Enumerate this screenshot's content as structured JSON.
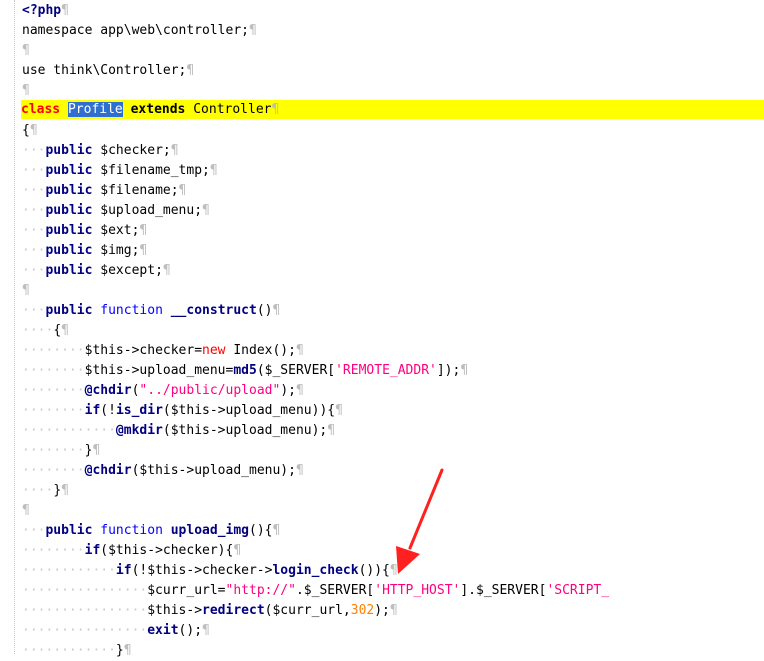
{
  "editor": {
    "lines": [
      [
        "<?php"
      ],
      [
        "namespace app\\web\\controller;"
      ],
      [
        ""
      ],
      [
        "use think\\Controller;"
      ],
      [
        ""
      ],
      [
        "class",
        " ",
        "Profile",
        " ",
        "extends",
        " Controller"
      ],
      [
        "{"
      ],
      [
        "public",
        " $checker;"
      ],
      [
        "public",
        " $filename_tmp;"
      ],
      [
        "public",
        " $filename;"
      ],
      [
        "public",
        " $upload_menu;"
      ],
      [
        "public",
        " $ext;"
      ],
      [
        "public",
        " $img;"
      ],
      [
        "public",
        " $except;"
      ],
      [
        ""
      ],
      [
        "public",
        " ",
        "function",
        " ",
        "__construct",
        "()"
      ],
      [
        "{"
      ],
      [
        "$this->checker=",
        "new",
        " Index();"
      ],
      [
        "$this->upload_menu=",
        "md5",
        "($_SERVER[",
        "'REMOTE_ADDR'",
        "]);"
      ],
      [
        "@chdir",
        "(",
        "\"../public/upload\"",
        ");"
      ],
      [
        "if",
        "(!",
        "is_dir",
        "($this->upload_menu)){"
      ],
      [
        "@mkdir",
        "($this->upload_menu);"
      ],
      [
        "}"
      ],
      [
        "@chdir",
        "($this->upload_menu);"
      ],
      [
        "}"
      ],
      [
        ""
      ],
      [
        "public",
        " ",
        "function",
        " ",
        "upload_img",
        "(){"
      ],
      [
        "if",
        "($this->checker){"
      ],
      [
        "if",
        "(!$this->checker->",
        "login_check",
        "()){"
      ],
      [
        "$curr_url=",
        "\"http://\"",
        ".$_SERVER[",
        "'HTTP_HOST'",
        "].$_SERVER[",
        "'SCRIPT_"
      ],
      [
        "$this->",
        "redirect",
        "($curr_url,",
        "302",
        ");"
      ],
      [
        "exit",
        "();"
      ],
      [
        "}"
      ]
    ]
  },
  "colors": {
    "highlight": "#ffff00",
    "arrow": "#ff2020",
    "selection": "#2f6fcf"
  }
}
